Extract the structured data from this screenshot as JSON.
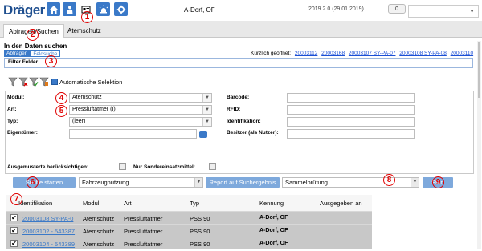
{
  "header": {
    "logo": "Dräger",
    "location": "A-Dorf, OF",
    "version": "2019.2.0 (29.01.2019)",
    "counter": "0",
    "user_select_value": ""
  },
  "tabs": [
    {
      "label": "Abfragen/Suchen"
    },
    {
      "label": "Atemschutz"
    }
  ],
  "search": {
    "heading": "In den Daten suchen",
    "subtabs": [
      "Abfragen",
      "Feldsuche"
    ],
    "recent_label": "Kürzlich geöffnet:",
    "recent_links": [
      "20003112",
      "20003168",
      "20003107 SY-PA-07",
      "20003108 SY-PA-08",
      "20003110"
    ],
    "filter_label": "Filter Felder",
    "auto_selection_label": "Automatische Selektion"
  },
  "form": {
    "modul_label": "Modul:",
    "modul_value": "Atemschutz",
    "art_label": "Art:",
    "art_value": "Pressluftatmer (I)",
    "typ_label": "Typ:",
    "typ_value": "(leer)",
    "eigentuemer_label": "Eigentümer:",
    "barcode_label": "Barcode:",
    "rfid_label": "RFID:",
    "identifikation_label": "Identifikation:",
    "besitzer_label": "Besitzer (als Nutzer):",
    "ausgemusterte_label": "Ausgemusterte berücksichtigen:",
    "sonder_label": "Nur Sondereinsatzmittel:"
  },
  "actions": {
    "search_button": "Suche starten",
    "select1_value": "Fahrzeugnutzung",
    "report_button": "Report auf Suchergebnis",
    "select2_value": "Sammelprüfung",
    "start_button": "Start"
  },
  "table": {
    "columns": [
      "Identifikation",
      "Modul",
      "Art",
      "Typ",
      "Kennung",
      "Ausgegeben an"
    ],
    "rows": [
      {
        "checked": "✔",
        "id": "20003108 SY-PA-0",
        "modul": "Atemschutz",
        "art": "Pressluftatmer",
        "typ": "PSS 90",
        "kennung": "A-Dorf, OF",
        "ausgegeben": ""
      },
      {
        "checked": "✔",
        "id": "20003102 - 543387",
        "modul": "Atemschutz",
        "art": "Pressluftatmer",
        "typ": "PSS 90",
        "kennung": "A-Dorf, OF",
        "ausgegeben": ""
      },
      {
        "checked": "✔",
        "id": "20003104 - 543389",
        "modul": "Atemschutz",
        "art": "Pressluftatmer",
        "typ": "PSS 90",
        "kennung": "A-Dorf, OF",
        "ausgegeben": ""
      }
    ]
  },
  "markers": [
    "1",
    "2",
    "3",
    "4",
    "5",
    "6",
    "7",
    "8",
    "9"
  ],
  "colors": {
    "accent": "#3a79c8",
    "marker": "#e00000",
    "row_bg": "#c8c8c8"
  }
}
